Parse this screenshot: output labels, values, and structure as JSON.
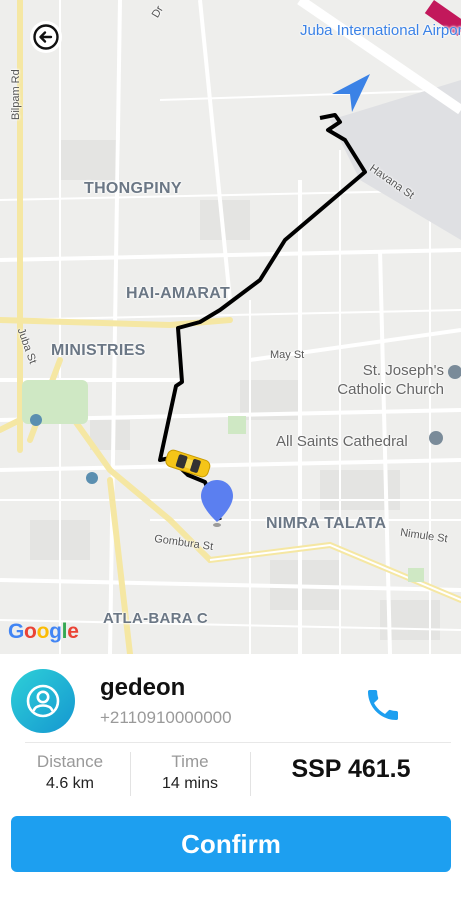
{
  "map": {
    "labels": {
      "airport": "Juba International Airport",
      "thongpiny": "THONGPINY",
      "hai_amarat": "HAI-AMARAT",
      "ministries": "MINISTRIES",
      "nimra_talata": "NIMRA TALATA",
      "atla_bara": "ATLA-BARA C",
      "st_josephs": "St. Joseph's Catholic Church",
      "all_saints": "All Saints Cathedral",
      "bilpam_rd": "Bilpam Rd",
      "havana_st": "Havana St",
      "may_st": "May St",
      "gombura_st": "Gombura St",
      "nimule_st": "Nimule St",
      "juba_st": "Juba St",
      "ring_dr": "Dr"
    },
    "google_logo": [
      "G",
      "o",
      "o",
      "g",
      "l",
      "e"
    ],
    "google_colors": [
      "#4285F4",
      "#EA4335",
      "#FBBC05",
      "#4285F4",
      "#34A853",
      "#EA4335"
    ],
    "route_color": "#000000",
    "pin_color": "#5b7ff0",
    "taxi_color": "#f5c518",
    "back_icon": "arrow-left-circle-icon"
  },
  "driver": {
    "name": "gedeon",
    "phone": "+2110910000000",
    "avatar_icon": "user-circle-icon",
    "call_icon": "phone-icon"
  },
  "trip": {
    "distance_label": "Distance",
    "distance_value": "4.6 km",
    "time_label": "Time",
    "time_value": "14 mins",
    "price": "SSP 461.5"
  },
  "actions": {
    "confirm_label": "Confirm"
  },
  "colors": {
    "accent": "#1d9ff0",
    "avatar_gradient": [
      "#2ed0d8",
      "#1597d0"
    ]
  }
}
